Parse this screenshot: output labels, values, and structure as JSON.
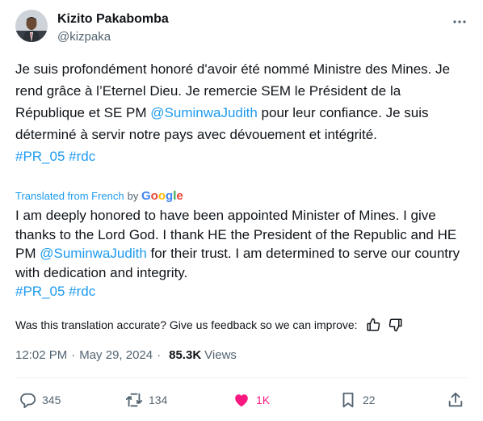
{
  "author": {
    "name": "Kizito Pakabomba",
    "handle": "@kizpaka"
  },
  "original_text": {
    "part1": "Je suis profondément honoré d'avoir été nommé Ministre des Mines. Je rend grâce à l’Eternel Dieu. Je remercie SEM le Président de la République et SE PM ",
    "mention": "@SuminwaJudith",
    "part2": " pour leur confiance. Je suis déterminé à servir notre pays avec dévouement et intégrité.",
    "hashtag1": "#PR_05",
    "hashtag2": "#rdc"
  },
  "translation_label": {
    "prefix": "Translated from French",
    "by": "by",
    "provider": "Google"
  },
  "translated_text": {
    "part1": "I am deeply honored to have been appointed Minister of Mines. I give thanks to the Lord God. I thank HE the President of the Republic and HE PM ",
    "mention": "@SuminwaJudith",
    "part2": " for their trust. I am determined to serve our country with dedication and integrity.",
    "hashtag1": "#PR_05",
    "hashtag2": "#rdc"
  },
  "feedback": {
    "question": "Was this translation accurate? Give us feedback so we can improve:",
    "thumbs_up_icon": "thumbs-up-icon",
    "thumbs_down_icon": "thumbs-down-icon"
  },
  "meta": {
    "time": "12:02 PM",
    "separator": "·",
    "date": "May 29, 2024",
    "views_count": "85.3K",
    "views_label": "Views"
  },
  "actions": {
    "replies": "345",
    "reposts": "134",
    "likes": "1K",
    "bookmarks": "22",
    "liked": true
  },
  "colors": {
    "link": "#1d9bf0",
    "secondary_text": "#536471",
    "like_active": "#f91880"
  }
}
